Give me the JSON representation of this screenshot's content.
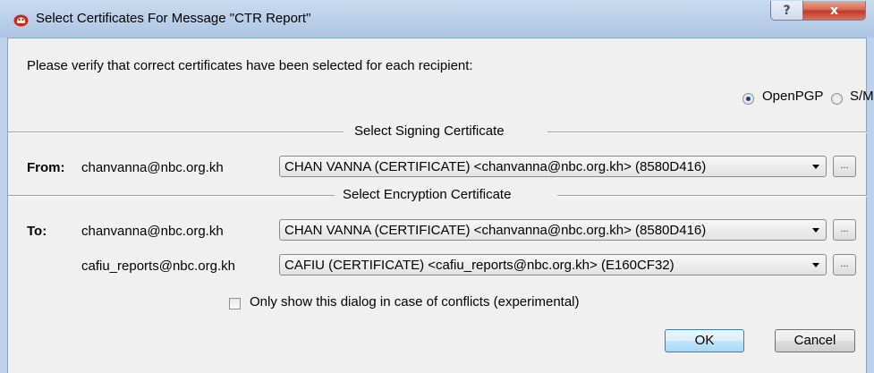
{
  "window": {
    "title": "Select Certificates For Message \"CTR Report\"",
    "help_label": "?",
    "close_label": "x"
  },
  "intro_text": "Please verify that correct certificates have been selected for each recipient:",
  "format": {
    "openpgp_label": "OpenPGP",
    "smime_label": "S/MIME",
    "selected": "OpenPGP"
  },
  "signing": {
    "section_title": "Select Signing Certificate",
    "from_label": "From:",
    "address": "chanvanna@nbc.org.kh",
    "certificate": "CHAN VANNA (CERTIFICATE) <chanvanna@nbc.org.kh> (8580D416)",
    "details_button": "..."
  },
  "encryption": {
    "section_title": "Select Encryption Certificate",
    "to_label": "To:",
    "recipients": [
      {
        "address": "chanvanna@nbc.org.kh",
        "certificate": "CHAN VANNA (CERTIFICATE) <chanvanna@nbc.org.kh> (8580D416)",
        "details_button": "..."
      },
      {
        "address": "cafiu_reports@nbc.org.kh",
        "certificate": "CAFIU (CERTIFICATE) <cafiu_reports@nbc.org.kh> (E160CF32)",
        "details_button": "..."
      }
    ]
  },
  "conflicts_checkbox": {
    "label": "Only show this dialog in case of conflicts (experimental)",
    "checked": false
  },
  "buttons": {
    "ok": "OK",
    "cancel": "Cancel"
  },
  "colors": {
    "titlebar": "#b7cde8",
    "dialog_bg": "#f0f0f0",
    "close_button": "#c0392b",
    "default_button_border": "#3c7fb1"
  }
}
